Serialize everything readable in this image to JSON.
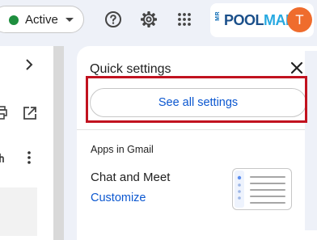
{
  "header": {
    "status_label": "Active",
    "brand_vertical": "MR",
    "brand_pool": "POOL",
    "brand_man": "MAN",
    "avatar_initial": "T"
  },
  "quick_settings": {
    "title": "Quick settings",
    "see_all_label": "See all settings",
    "section_heading": "Apps in Gmail",
    "setting_name": "Chat and Meet",
    "customize_label": "Customize"
  },
  "colors": {
    "status_green": "#1e8e3e",
    "link_blue": "#0b57d0",
    "highlight_red": "#c1121f",
    "avatar_orange": "#ef6c2d"
  },
  "icons": [
    "help-icon",
    "settings-gear-icon",
    "apps-grid-icon",
    "chevron-right-icon",
    "print-icon",
    "open-in-new-icon",
    "more-vertical-icon",
    "close-icon"
  ]
}
